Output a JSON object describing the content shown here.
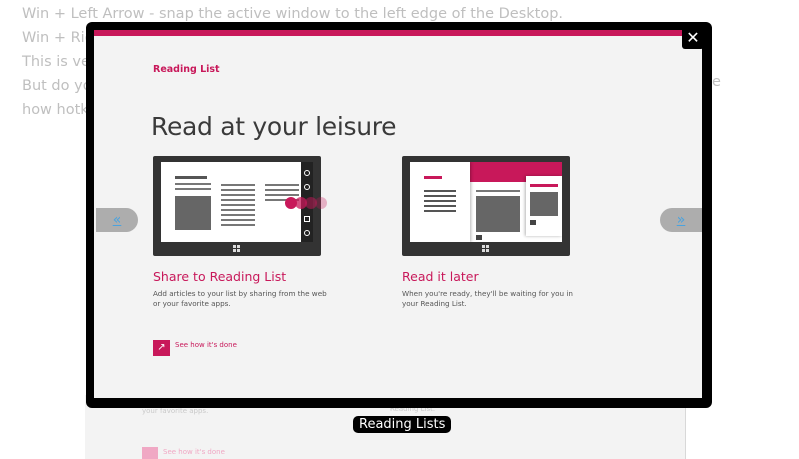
{
  "background": {
    "lines": [
      "Win + Left Arrow - snap the active window to the left edge of the Desktop.",
      "Win + Rig",
      "This is ve",
      "But do yo",
      "how hotke"
    ],
    "right_fragment": "e",
    "peek_desc": "your favorite apps.",
    "peek_desc2": "Reading List.",
    "peek_link": "See how it's done"
  },
  "slide": {
    "section_title": "Reading List",
    "heading": "Read at your leisure",
    "cards": [
      {
        "title": "Share to Reading List",
        "description": "Add articles to your list by sharing from the web or your favorite apps."
      },
      {
        "title": "Read it later",
        "description": "When you're ready, they'll be waiting for you in your Reading List."
      }
    ],
    "see_how_link": "See how it's done",
    "see_how_icon": "arrow-up-right-icon"
  },
  "lightbox": {
    "close_label": "✕",
    "prev_label": "«",
    "next_label": "»",
    "caption": "Reading Lists"
  },
  "colors": {
    "accent": "#c8185a",
    "nav_arrow": "#4aa3df"
  }
}
